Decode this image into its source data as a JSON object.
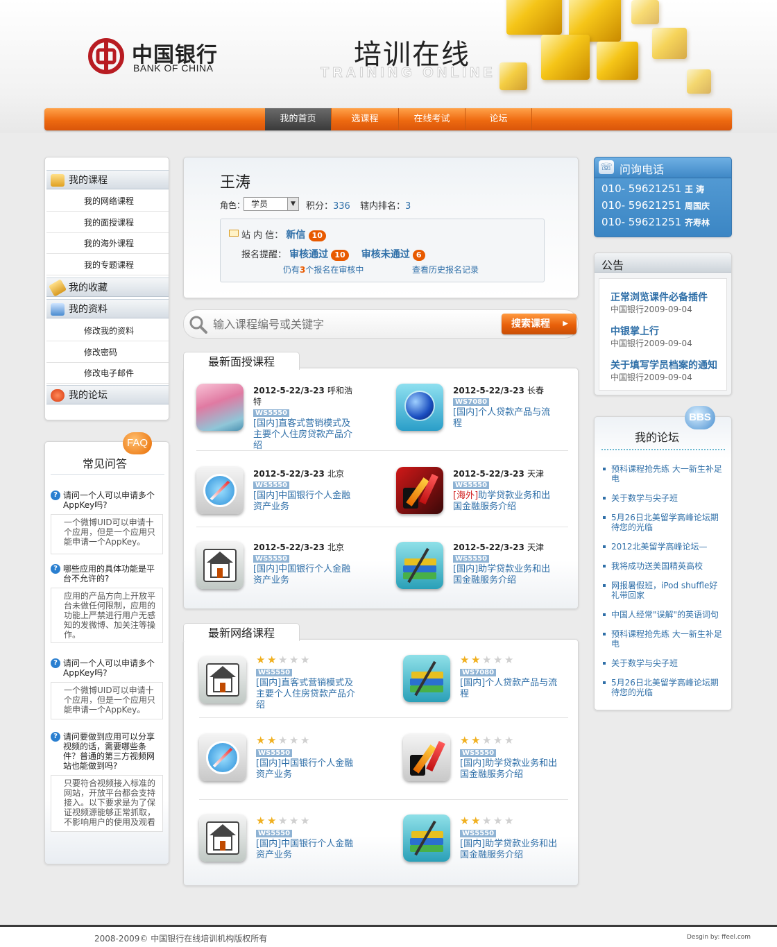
{
  "header": {
    "brand_cn": "中国银行",
    "brand_en": "BANK OF CHINA",
    "title_cn": "培训在线",
    "title_en": "TRAINING ONLINE"
  },
  "nav": [
    "我的首页",
    "选课程",
    "在线考试",
    "论坛"
  ],
  "left_menu": {
    "my_courses": "我的课程",
    "course_items": [
      "我的网络课程",
      "我的面授课程",
      "我的海外课程",
      "我的专题课程"
    ],
    "favorites": "我的收藏",
    "profile": "我的资料",
    "profile_items": [
      "修改我的资料",
      "修改密码",
      "修改电子邮件"
    ],
    "forum": "我的论坛"
  },
  "faq": {
    "badge": "FAQ",
    "title": "常见问答",
    "items": [
      {
        "q": "请问一个人可以申请多个AppKey吗?",
        "a": "一个微博UID可以申请十个应用，但是一个应用只能申请一个AppKey。"
      },
      {
        "q": "哪些应用的具体功能是平台不允许的?",
        "a": "应用的产品方向上开放平台未做任何限制，应用的功能上严禁进行用户无感知的发微博、加关注等操作。"
      },
      {
        "q": "请问一个人可以申请多个AppKey吗?",
        "a": "一个微博UID可以申请十个应用，但是一个应用只能申请一个AppKey。"
      },
      {
        "q": "请问要做到应用可以分享视频的话，需要哪些条件？普通的第三方视频网站也能做到吗?",
        "a": "只要符合视频接入标准的网站，开放平台都会支持接入。以下要求是为了保证视频源能够正常抓取，不影响用户的使用及观看"
      }
    ]
  },
  "user": {
    "name": "王涛",
    "role_label": "角色：",
    "role": "学员",
    "points_label": "积分：",
    "points": "336",
    "rank_label": "辖内排名：",
    "rank": "3",
    "msg_label": "站 内 信：",
    "msg_new": "新信",
    "msg_count": "10",
    "remind_label": "报名提醒：",
    "approved": "审核通过",
    "approved_count": "10",
    "rejected": "审核未通过",
    "rejected_count": "6",
    "pending_pre": "仍有",
    "pending_num": "3",
    "pending_post": "个报名在审核中",
    "history": "查看历史报名记录"
  },
  "search": {
    "placeholder": "输入课程编号或关键字",
    "button": "搜索课程"
  },
  "face_courses": {
    "title": "最新面授课程",
    "items": [
      {
        "date": "2012-5-22/3-23",
        "loc": "呼和浩特",
        "code": "WS5550",
        "tag": "[国内]",
        "title": "直客式营销模式及主要个人住房贷款产品介绍",
        "icon": "gradient-app-icon"
      },
      {
        "date": "2012-5-22/3-23",
        "loc": "长春",
        "code": "WS7080",
        "tag": "[国内]",
        "title": "个人贷款产品与流程",
        "icon": "globe-icon"
      },
      {
        "date": "2012-5-22/3-23",
        "loc": "北京",
        "code": "WS5550",
        "tag": "[国内]",
        "title": "中国银行个人金融资产业务",
        "icon": "compass-icon"
      },
      {
        "date": "2012-5-22/3-23",
        "loc": "天津",
        "code": "WS5550",
        "tag": "[海外]",
        "title": "助学贷款业务和出国金融服务介绍",
        "icon": "chart-arrows-icon"
      },
      {
        "date": "2012-5-22/3-23",
        "loc": "北京",
        "code": "WS5550",
        "tag": "[国内]",
        "title": "中国银行个人金融资产业务",
        "icon": "house-icon"
      },
      {
        "date": "2012-5-22/3-23",
        "loc": "天津",
        "code": "WS5550",
        "tag": "[国内]",
        "title": "助学贷款业务和出国金融服务介绍",
        "icon": "books-icon"
      }
    ]
  },
  "online_courses": {
    "title": "最新网络课程",
    "items": [
      {
        "rating": 2,
        "code": "WS5550",
        "tag": "[国内]",
        "title": "直客式营销模式及主要个人住房贷款产品介绍",
        "icon": "house-icon"
      },
      {
        "rating": 2,
        "code": "WS7080",
        "tag": "[国内]",
        "title": "个人贷款产品与流程",
        "icon": "books-icon"
      },
      {
        "rating": 2,
        "code": "WS5550",
        "tag": "[国内]",
        "title": "中国银行个人金融资产业务",
        "icon": "compass-icon"
      },
      {
        "rating": 2,
        "code": "WS5550",
        "tag": "[国内]",
        "title": "助学贷款业务和出国金融服务介绍",
        "icon": "chart-arrows-icon"
      },
      {
        "rating": 2,
        "code": "WS5550",
        "tag": "[国内]",
        "title": "中国银行个人金融资产业务",
        "icon": "house-icon"
      },
      {
        "rating": 2,
        "code": "WS5550",
        "tag": "[国内]",
        "title": "助学贷款业务和出国金融服务介绍",
        "icon": "books-icon"
      }
    ]
  },
  "hotline": {
    "title": "问询电话",
    "lines": [
      {
        "num": "010- 59621251",
        "name": "王 涛"
      },
      {
        "num": "010- 59621251",
        "name": "周国庆"
      },
      {
        "num": "010- 59621251",
        "name": "齐寿林"
      }
    ]
  },
  "notice": {
    "title": "公告",
    "items": [
      {
        "title": "正常浏览课件必备插件",
        "src": "中国银行",
        "date": "2009-09-04"
      },
      {
        "title": "中银掌上行",
        "src": "中国银行",
        "date": "2009-09-04"
      },
      {
        "title": "关于填写学员档案的通知",
        "src": "中国银行",
        "date": "2009-09-04"
      }
    ]
  },
  "forum": {
    "badge": "BBS",
    "title": "我的论坛",
    "items": [
      "预科课程抢先练 大一新生补足电",
      "关于数学与尖子班",
      "5月26日北美留学高峰论坛期待您的光临",
      "2012北美留学高峰论坛—",
      "我将成功送美国精英高校",
      "网报暑假班，iPod shuffle好礼带回家",
      "中国人经常\"误解\"的英语词句",
      "预科课程抢先练 大一新生补足电",
      "关于数学与尖子班",
      "5月26日北美留学高峰论坛期待您的光临"
    ]
  },
  "footer": {
    "copyright": "2008-2009© 中国银行在线培训机构版权所有",
    "design": "Desgin by: ffeel.com"
  },
  "colors": {
    "accent": "#ee6a10",
    "link": "#2f6fa8",
    "brand_red": "#b81c22"
  }
}
